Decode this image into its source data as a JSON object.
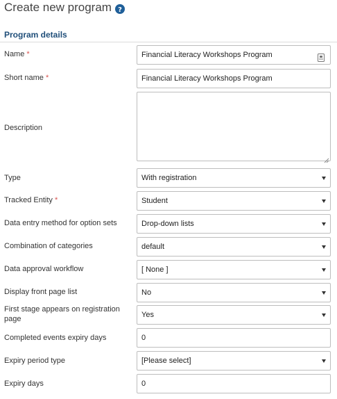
{
  "page": {
    "title": "Create new program",
    "help_icon": "question-circle-icon"
  },
  "section": {
    "title": "Program details"
  },
  "fields": {
    "name": {
      "label": "Name",
      "required_mark": "*",
      "value": "Financial Literacy Workshops Program",
      "icon": "translate-icon"
    },
    "short_name": {
      "label": "Short name",
      "required_mark": "*",
      "value": "Financial Literacy Workshops Program"
    },
    "description": {
      "label": "Description",
      "value": ""
    },
    "type": {
      "label": "Type",
      "value": "With registration"
    },
    "tracked_entity": {
      "label": "Tracked Entity",
      "required_mark": "*",
      "value": "Student"
    },
    "data_entry_method": {
      "label": "Data entry method for option sets",
      "value": "Drop-down lists"
    },
    "combination_of_categories": {
      "label": "Combination of categories",
      "value": "default"
    },
    "data_approval_workflow": {
      "label": "Data approval workflow",
      "value": "[ None ]"
    },
    "display_front_page_list": {
      "label": "Display front page list",
      "value": "No"
    },
    "first_stage_on_registration": {
      "label": "First stage appears on registration page",
      "value": "Yes"
    },
    "completed_events_expiry_days": {
      "label": "Completed events expiry days",
      "value": "0"
    },
    "expiry_period_type": {
      "label": "Expiry period type",
      "value": "[Please select]"
    },
    "expiry_days": {
      "label": "Expiry days",
      "value": "0"
    }
  },
  "colors": {
    "section_title": "#1f4e79",
    "required": "#d9534f",
    "help_icon": "#1f5f99"
  }
}
